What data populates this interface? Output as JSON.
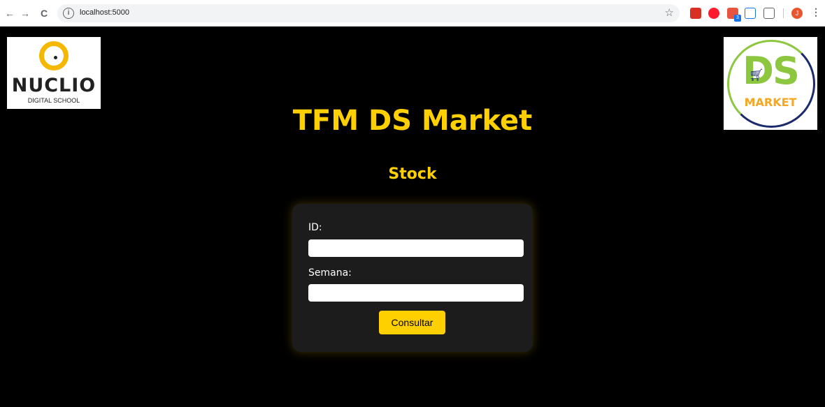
{
  "browser": {
    "nav_back": "←",
    "nav_forward": "→",
    "nav_reload": "C",
    "info_glyph": "i",
    "url": "localhost:5000",
    "star": "☆",
    "profile_initial": "J",
    "menu": "⋮",
    "extension_badge": "3"
  },
  "logos": {
    "left": {
      "word": "NUCLIO",
      "sub": "DIGITAL SCHOOL"
    },
    "right": {
      "letters": "DS",
      "word": "MARKET"
    }
  },
  "page": {
    "title": "TFM DS Market",
    "subtitle": "Stock"
  },
  "form": {
    "id_label": "ID:",
    "id_value": "",
    "week_label": "Semana:",
    "week_value": "",
    "submit_label": "Consultar"
  },
  "colors": {
    "accent": "#ffd000",
    "background": "#000000",
    "card": "#1c1c1c"
  }
}
